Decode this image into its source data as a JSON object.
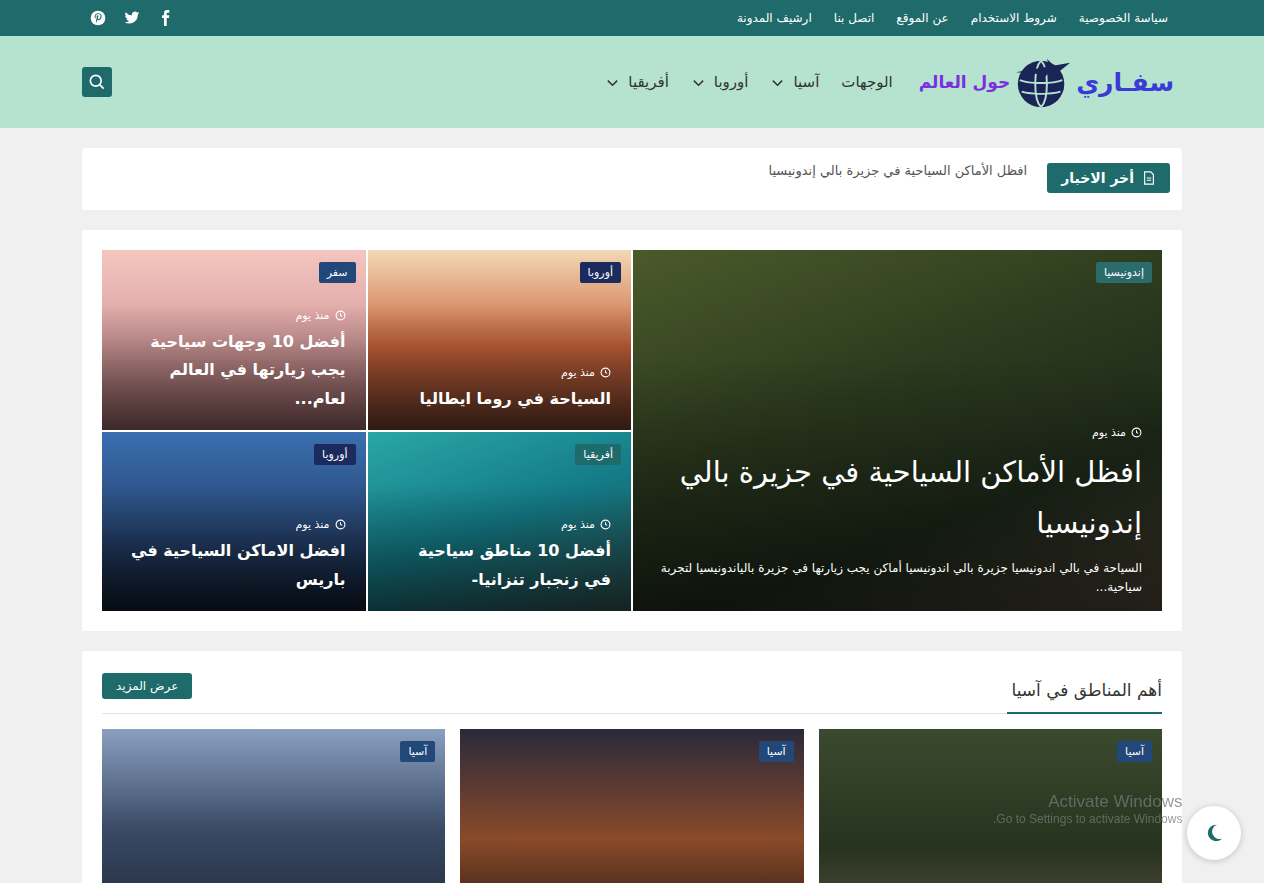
{
  "top_links": [
    "سياسة الخصوصية",
    "شروط الاستخدام",
    "عن الموقع",
    "اتصل بنا",
    "ارشيف المدونة"
  ],
  "logo": {
    "name": "سفـاري",
    "tagline": "حول العالم"
  },
  "nav": [
    {
      "label": "الوجهات",
      "dropdown": false
    },
    {
      "label": "آسيا",
      "dropdown": true
    },
    {
      "label": "أوروبا",
      "dropdown": true
    },
    {
      "label": "أفريقيا",
      "dropdown": true
    }
  ],
  "ticker": {
    "label": "أخر الاخبار",
    "headline": "افظل الأماكن السياحية في جزيرة بالي إندونيسيا"
  },
  "featured": {
    "main": {
      "tag": "إندونيسيا",
      "color": "#2a6b6b",
      "time": "منذ يوم",
      "title": "افظل الأماكن السياحية في جزيرة بالي إندونيسيا",
      "excerpt": "السياحة في بالي اندونيسيا جزيرة بالي اندونيسيا أماكن يجب زيارتها في جزيرة بالياندونيسيا لتجربة سياحية..."
    },
    "tiles": [
      {
        "tag": "أوروبا",
        "color": "#1c2b5e",
        "time": "منذ يوم",
        "title": "السياحة في روما ايطاليا"
      },
      {
        "tag": "سفر",
        "color": "#22487a",
        "time": "منذ يوم",
        "title": "أفضل 10 وجهات سياحية يجب زيارتها في العالم لعام..."
      },
      {
        "tag": "أفريقيا",
        "color": "#1f6b6b",
        "time": "منذ يوم",
        "title": "أفضل 10 مناطق سياحية في زنجبار تنزانيا-"
      },
      {
        "tag": "أوروبا",
        "color": "#1c2b5e",
        "time": "منذ يوم",
        "title": "افضل الاماكن السياحية في باريس"
      }
    ]
  },
  "section": {
    "title": "أهم المناطق في آسيا",
    "more": "عرض المزيد",
    "cards": [
      {
        "tag": "آسيا",
        "color": "#22487a"
      },
      {
        "tag": "آسيا",
        "color": "#22487a"
      },
      {
        "tag": "آسيا",
        "color": "#22487a"
      }
    ]
  },
  "watermark": {
    "title": "Activate Windows",
    "subtitle": "Go to Settings to activate Windows."
  }
}
